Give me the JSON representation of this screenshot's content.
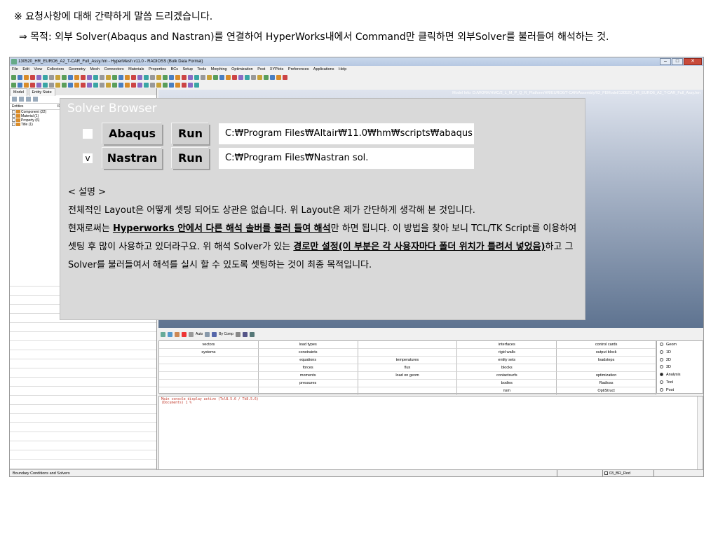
{
  "slide": {
    "line1": "※ 요청사항에 대해 간략하게 말씀 드리겠습니다.",
    "line2": "⇒ 목적:  외부 Solver(Abaqus and Nastran)를 연결하여 HyperWorks내에서 Command만 클릭하면 외부Solver를 불러들여 해석하는 것."
  },
  "hypermesh": {
    "title": "130520_HR_EURO6_A2_T-CAR_Full_Assy.hm - HyperMesh v11.0 - RADIOSS (Bulk Data Format)",
    "menus": [
      "File",
      "Edit",
      "View",
      "Collectors",
      "Geometry",
      "Mesh",
      "Connectors",
      "Materials",
      "Properties",
      "BCs",
      "Setup",
      "Tools",
      "Morphing",
      "Optimization",
      "Post",
      "XYPlots",
      "Preferences",
      "Applications",
      "Help"
    ],
    "left_tabs": [
      "Model",
      "Entity State"
    ],
    "tree_header": {
      "entities": "Entities",
      "id": "ID"
    },
    "tree_items": [
      "Component (22)",
      "Material (1)",
      "Property (6)",
      "Title (1)"
    ],
    "model_info": "Model Info: D:/WORK/HMC/2_L_M_P_Q_R_Platform/HR/EURO6/T-CAR/Assembly/02_FEModel/130520_HR_EURO6_A2_T-CAR_Full_Assy.hm",
    "panel_toolbar": {
      "auto": "Auto",
      "by_comp": "By Comp"
    },
    "menu_grid": [
      [
        "vectors",
        "load types",
        "",
        "interfaces",
        "control cards"
      ],
      [
        "systems",
        "constraints",
        "",
        "rigid walls",
        "output block"
      ],
      [
        "",
        "equations",
        "temperatures",
        "entity sets",
        "loadsteps"
      ],
      [
        "",
        "forces",
        "flux",
        "blocks",
        ""
      ],
      [
        "",
        "moments",
        "load on geom",
        "contactsurfs",
        "optimization"
      ],
      [
        "",
        "pressures",
        "",
        "bodies",
        "Radioss"
      ],
      [
        "",
        "",
        "",
        "nsm",
        "OptiStruct"
      ]
    ],
    "radio_options": [
      "Geom",
      "1D",
      "2D",
      "3D",
      "Analysis",
      "Tool",
      "Post"
    ],
    "radio_selected": "Analysis",
    "console": [
      "Main console display active (Tcl8.5.6 / Tk8.5.6)",
      "(Documents) 1 %"
    ],
    "status": {
      "left": "Boundary Conditions and Solvers",
      "component": "03_BR_Rod"
    }
  },
  "solver_browser": {
    "title": "Solver Browser",
    "rows": [
      {
        "checked": "",
        "name": "Abaqus",
        "run": "Run",
        "path": "C:₩Program Files₩Altair₩11.0₩hm₩scripts₩abaqus"
      },
      {
        "checked": "v",
        "name": "Nastran",
        "run": "Run",
        "path": "C:₩Program Files₩Nastran sol."
      }
    ]
  },
  "description": {
    "heading": "< 설명 >",
    "p1": " 전체적인 Layout은 어떻게 셋팅 되어도 상관은 없습니다. 위 Layout은 제가 간단하게 생각해 본 것입니다.",
    "p2_pre": " 현재로써는 ",
    "p2_u1": "Hyperworks 안에서 다른 해석 솔버를 불러 들여 해석",
    "p2_mid": "만 하면 됩니다. 이 방법을 찾아 보니 TCL/TK Script를 이용하여 셋팅 후 많이 사용하고 있더라구요. 위 해석 Solver가 있는 ",
    "p2_u2": "경로만 설정(이 부분은 각 사용자마다 폴더 위치가 틀려서 넣었음)",
    "p2_post": "하고 그 Solver를 불러들여서 해석를 실시 할 수 있도록 셋팅하는 것이 최종 목적입니다."
  }
}
